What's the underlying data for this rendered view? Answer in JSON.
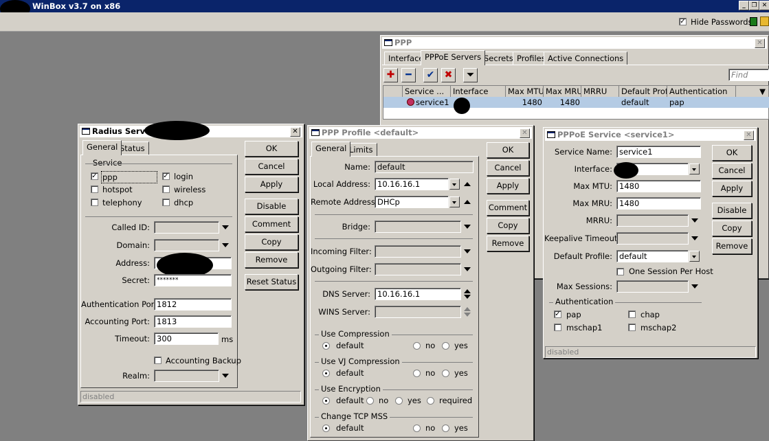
{
  "app": {
    "title": "WinBox v3.7 on x86"
  },
  "toolbar": {
    "hide_passwords_label": "Hide Passwords",
    "hide_passwords_checked": true
  },
  "ppp": {
    "title": "PPP",
    "tabs": [
      "Interface",
      "PPPoE Servers",
      "Secrets",
      "Profiles",
      "Active Connections"
    ],
    "selected_tab": "PPPoE Servers",
    "find_placeholder": "Find",
    "columns": [
      "Service ...",
      "Interface",
      "Max MTU",
      "Max MRU",
      "MRRU",
      "Default Profile",
      "Authentication"
    ],
    "rows": [
      {
        "service": "service1",
        "interface": "",
        "max_mtu": "1480",
        "max_mru": "1480",
        "mrru": "",
        "default_profile": "default",
        "authentication": "pap"
      }
    ]
  },
  "radius": {
    "title": "Radius Server",
    "tabs": [
      "General",
      "Status"
    ],
    "service_group": "Service",
    "services": [
      {
        "label": "ppp",
        "checked": true
      },
      {
        "label": "login",
        "checked": true
      },
      {
        "label": "hotspot",
        "checked": false
      },
      {
        "label": "wireless",
        "checked": false
      },
      {
        "label": "telephony",
        "checked": false
      },
      {
        "label": "dhcp",
        "checked": false
      }
    ],
    "called_id_label": "Called ID:",
    "domain_label": "Domain:",
    "address_label": "Address:",
    "secret_label": "Secret:",
    "secret_value": "*******",
    "auth_port_label": "Authentication Port:",
    "auth_port_value": "1812",
    "acct_port_label": "Accounting Port:",
    "acct_port_value": "1813",
    "timeout_label": "Timeout:",
    "timeout_value": "300",
    "timeout_unit": "ms",
    "acct_backup_label": "Accounting Backup",
    "realm_label": "Realm:",
    "status": "disabled",
    "buttons": [
      "OK",
      "Cancel",
      "Apply",
      "Disable",
      "Comment",
      "Copy",
      "Remove",
      "Reset Status"
    ]
  },
  "profile": {
    "title": "PPP Profile <default>",
    "tabs": [
      "General",
      "Limits"
    ],
    "name_label": "Name:",
    "name_value": "default",
    "local_label": "Local Address:",
    "local_value": "10.16.16.1",
    "remote_label": "Remote Address:",
    "remote_value": "DHCp",
    "bridge_label": "Bridge:",
    "in_filter_label": "Incoming Filter:",
    "out_filter_label": "Outgoing Filter:",
    "dns_label": "DNS Server:",
    "dns_value": "10.16.16.1",
    "wins_label": "WINS Server:",
    "groups": [
      {
        "title": "Use Compression",
        "options": [
          "default",
          "no",
          "yes"
        ]
      },
      {
        "title": "Use VJ Compression",
        "options": [
          "default",
          "no",
          "yes"
        ]
      },
      {
        "title": "Use Encryption",
        "options": [
          "default",
          "no",
          "yes",
          "required"
        ]
      },
      {
        "title": "Change TCP MSS",
        "options": [
          "default",
          "no",
          "yes"
        ]
      }
    ],
    "buttons": [
      "OK",
      "Cancel",
      "Apply",
      "Comment",
      "Copy",
      "Remove"
    ]
  },
  "pppoe": {
    "title": "PPPoE Service <service1>",
    "service_name_label": "Service Name:",
    "service_name_value": "service1",
    "interface_label": "Interface:",
    "max_mtu_label": "Max MTU:",
    "max_mtu_value": "1480",
    "max_mru_label": "Max MRU:",
    "max_mru_value": "1480",
    "mrru_label": "MRRU:",
    "keepalive_label": "Keepalive Timeout:",
    "default_profile_label": "Default Profile:",
    "default_profile_value": "default",
    "one_session_label": "One Session Per Host",
    "max_sessions_label": "Max Sessions:",
    "auth_group": "Authentication",
    "auth": [
      {
        "label": "pap",
        "checked": true
      },
      {
        "label": "chap",
        "checked": false
      },
      {
        "label": "mschap1",
        "checked": false
      },
      {
        "label": "mschap2",
        "checked": false
      }
    ],
    "status": "disabled",
    "buttons": [
      "OK",
      "Cancel",
      "Apply",
      "Disable",
      "Copy",
      "Remove"
    ]
  }
}
